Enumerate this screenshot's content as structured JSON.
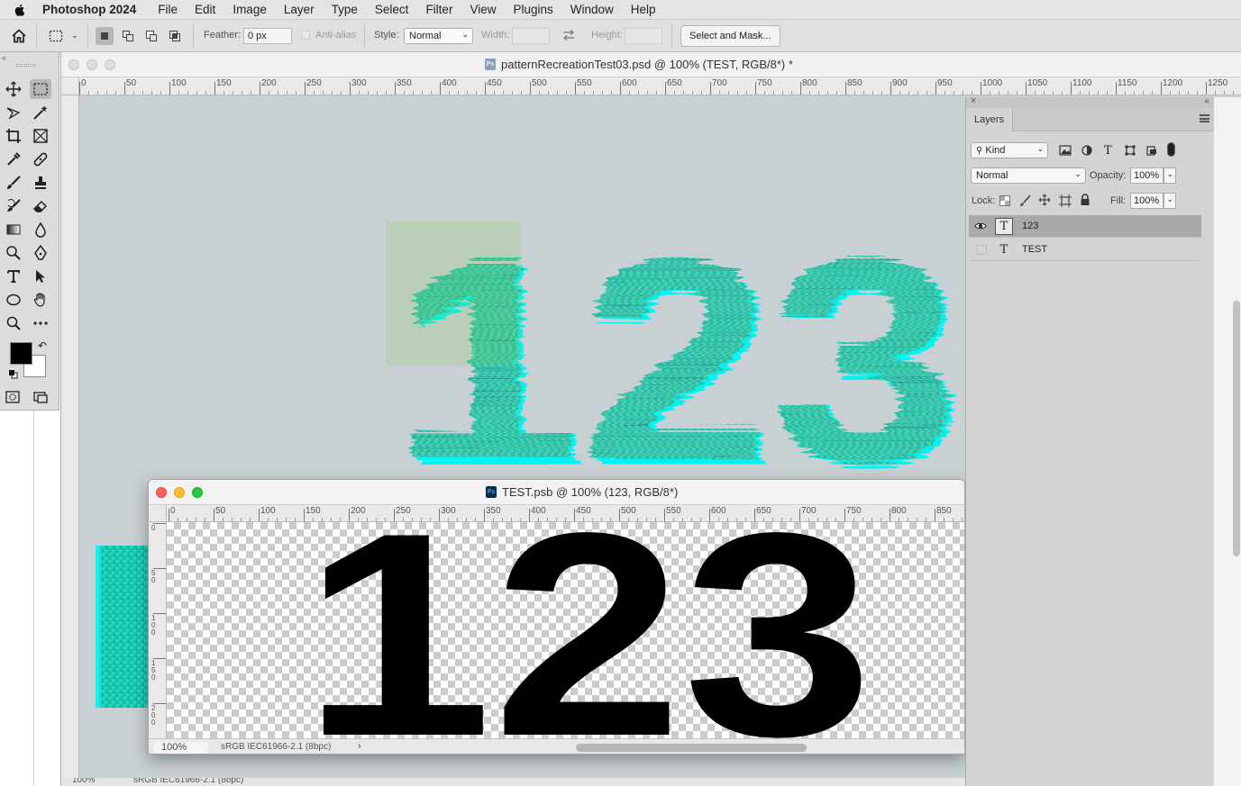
{
  "menubar": {
    "app_name": "Photoshop 2024",
    "items": [
      "File",
      "Edit",
      "Image",
      "Layer",
      "Type",
      "Select",
      "Filter",
      "View",
      "Plugins",
      "Window",
      "Help"
    ]
  },
  "options_bar": {
    "feather_label": "Feather:",
    "feather_value": "0 px",
    "antialias_label": "Anti-alias",
    "style_label": "Style:",
    "style_value": "Normal",
    "width_label": "Width:",
    "height_label": "Height:",
    "select_and_mask_label": "Select and Mask..."
  },
  "main_document": {
    "title": "patternRecreationTest03.psd @ 100% (TEST, RGB/8*) *",
    "canvas_text": "123",
    "ruler_ticks": [
      "0",
      "50",
      "100",
      "150",
      "200",
      "250",
      "300",
      "350",
      "400",
      "450",
      "500",
      "550",
      "600",
      "650",
      "700",
      "750",
      "800",
      "850",
      "900",
      "950",
      "1000",
      "1050",
      "1100",
      "1150",
      "1200",
      "1250"
    ],
    "status_zoom": "100%",
    "status_profile": "sRGB IEC61966-2.1 (8bpc)"
  },
  "sub_document": {
    "title": "TEST.psb @ 100% (123, RGB/8*)",
    "canvas_text": "123",
    "ruler_ticks": [
      "0",
      "50",
      "100",
      "150",
      "200",
      "250",
      "300",
      "350",
      "400",
      "450",
      "500",
      "550",
      "600",
      "650",
      "700",
      "750",
      "800",
      "850"
    ],
    "vruler_ticks": [
      "0",
      "50",
      "100",
      "150",
      "200"
    ],
    "status_zoom": "100%",
    "status_profile": "sRGB IEC61966-2.1 (8bpc)",
    "status_arrow": "›"
  },
  "layers_panel": {
    "tab_label": "Layers",
    "filter_kind": "Kind",
    "blend_mode": "Normal",
    "opacity_label": "Opacity:",
    "opacity_value": "100%",
    "lock_label": "Lock:",
    "fill_label": "Fill:",
    "fill_value": "100%",
    "layers": [
      {
        "name": "123",
        "type": "text",
        "visible": true,
        "selected": true
      },
      {
        "name": "TEST",
        "type": "text",
        "visible": false,
        "selected": false
      }
    ]
  },
  "colors": {
    "foreground": "#000000",
    "background": "#ffffff",
    "canvas_bg": "#c9d0d3",
    "glitch_cyan": "#00f0f0",
    "glitch_green": "#4fd37a"
  }
}
